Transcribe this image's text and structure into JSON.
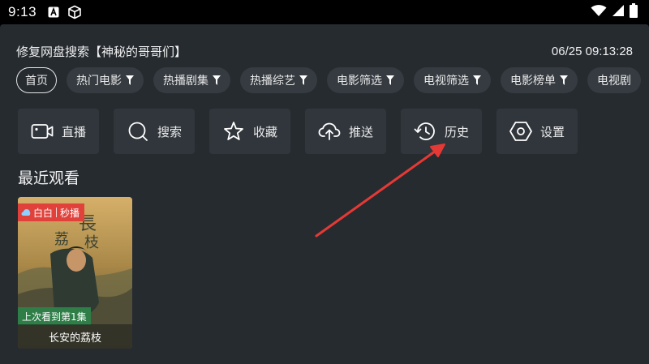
{
  "status_bar": {
    "time": "9:13",
    "icons": [
      "a-letter-icon",
      "cube-icon"
    ],
    "right_icons": [
      "wifi-icon",
      "signal-icon",
      "battery-icon"
    ]
  },
  "header": {
    "title": "修复网盘搜索【神秘的哥哥们】",
    "datetime": "06/25 09:13:28"
  },
  "tabs": [
    {
      "label": "首页",
      "active": true
    },
    {
      "label": "热门电影",
      "filter": true
    },
    {
      "label": "热播剧集",
      "filter": true
    },
    {
      "label": "热播综艺",
      "filter": true
    },
    {
      "label": "电影筛选",
      "filter": true
    },
    {
      "label": "电视筛选",
      "filter": true
    },
    {
      "label": "电影榜单",
      "filter": true
    },
    {
      "label": "电视剧"
    }
  ],
  "actions": [
    {
      "label": "直播",
      "icon": "video-camera-icon"
    },
    {
      "label": "搜索",
      "icon": "search-icon"
    },
    {
      "label": "收藏",
      "icon": "star-icon"
    },
    {
      "label": "推送",
      "icon": "cloud-upload-icon"
    },
    {
      "label": "历史",
      "icon": "history-icon"
    },
    {
      "label": "设置",
      "icon": "settings-hexagon-icon"
    }
  ],
  "recent": {
    "title": "最近观看",
    "items": [
      {
        "badge_source": "白白",
        "badge_tag": "秒播",
        "progress": "上次看到第1集",
        "name": "长安的荔枝"
      }
    ]
  },
  "colors": {
    "background": "#262b30",
    "chip": "#353b41",
    "action_tile": "#30363c",
    "badge": "#e0423b",
    "progress": "#2f7d47",
    "annotation_arrow": "#e53935"
  }
}
